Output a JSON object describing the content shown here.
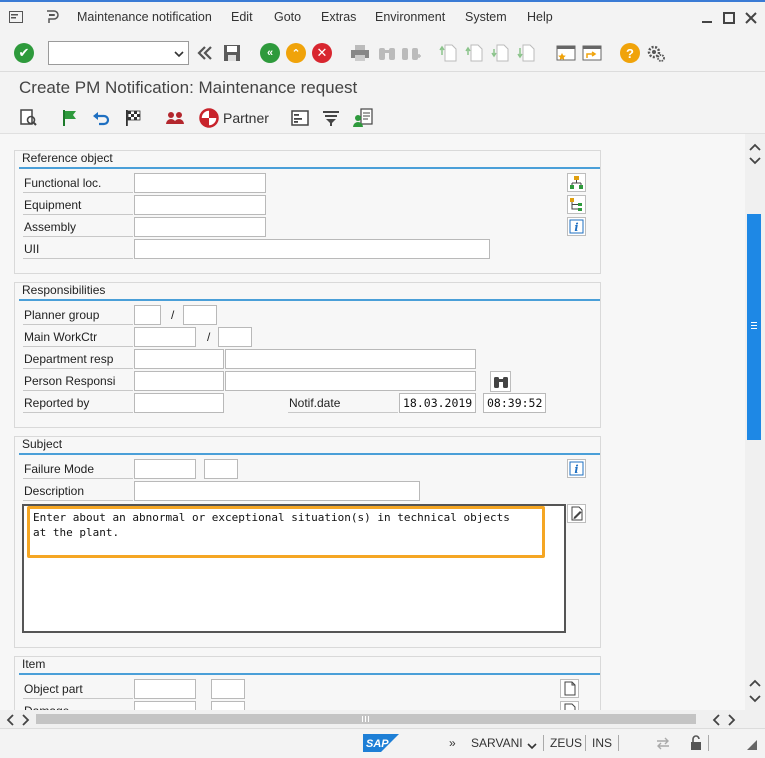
{
  "menu": {
    "items": [
      "Maintenance notification",
      "Edit",
      "Goto",
      "Extras",
      "Environment",
      "System",
      "Help"
    ]
  },
  "toolbar": {
    "command_value": "",
    "icons": [
      "enter-icon",
      "save-icon",
      "back-icon",
      "exit-icon",
      "cancel-icon",
      "print-icon",
      "find-icon",
      "find-next-icon",
      "first-page-icon",
      "previous-page-icon",
      "next-page-icon",
      "last-page-icon",
      "create-session-icon",
      "shortcut-icon",
      "help-icon",
      "settings-icon"
    ]
  },
  "title": "Create PM Notification: Maintenance request",
  "app_toolbar": {
    "partner_label": "Partner"
  },
  "reference_object": {
    "title": "Reference object",
    "functional_loc_label": "Functional loc.",
    "functional_loc_value": "",
    "equipment_label": "Equipment",
    "equipment_value": "",
    "assembly_label": "Assembly",
    "assembly_value": "",
    "uii_label": "UII",
    "uii_value": ""
  },
  "responsibilities": {
    "title": "Responsibilities",
    "planner_group_label": "Planner group",
    "main_workctr_label": "Main WorkCtr",
    "department_resp_label": "Department resp",
    "person_responsi_label": "Person Responsi",
    "reported_by_label": "Reported by",
    "reported_by_value": "",
    "notif_date_label": "Notif.date",
    "notif_date_value": "18.03.2019",
    "notif_time_value": "08:39:52",
    "slash": "/"
  },
  "subject": {
    "title": "Subject",
    "failure_mode_label": "Failure Mode",
    "description_label": "Description",
    "description_value": "",
    "long_text": "Enter about an abnormal or exceptional situation(s) in technical objects\nat the plant."
  },
  "item": {
    "title": "Item",
    "object_part_label": "Object part",
    "damage_label": "Damage"
  },
  "status": {
    "system_logo": "SAP",
    "user": "SARVANI",
    "server": "ZEUS",
    "mode": "INS"
  },
  "colors": {
    "accent_blue": "#4a9fd8",
    "scroll_thumb": "#1e88e5",
    "highlight_orange": "#f5a623",
    "ok_green": "#2e9a3c",
    "cancel_red": "#d8262f",
    "help_yellow": "#f0a30a"
  }
}
